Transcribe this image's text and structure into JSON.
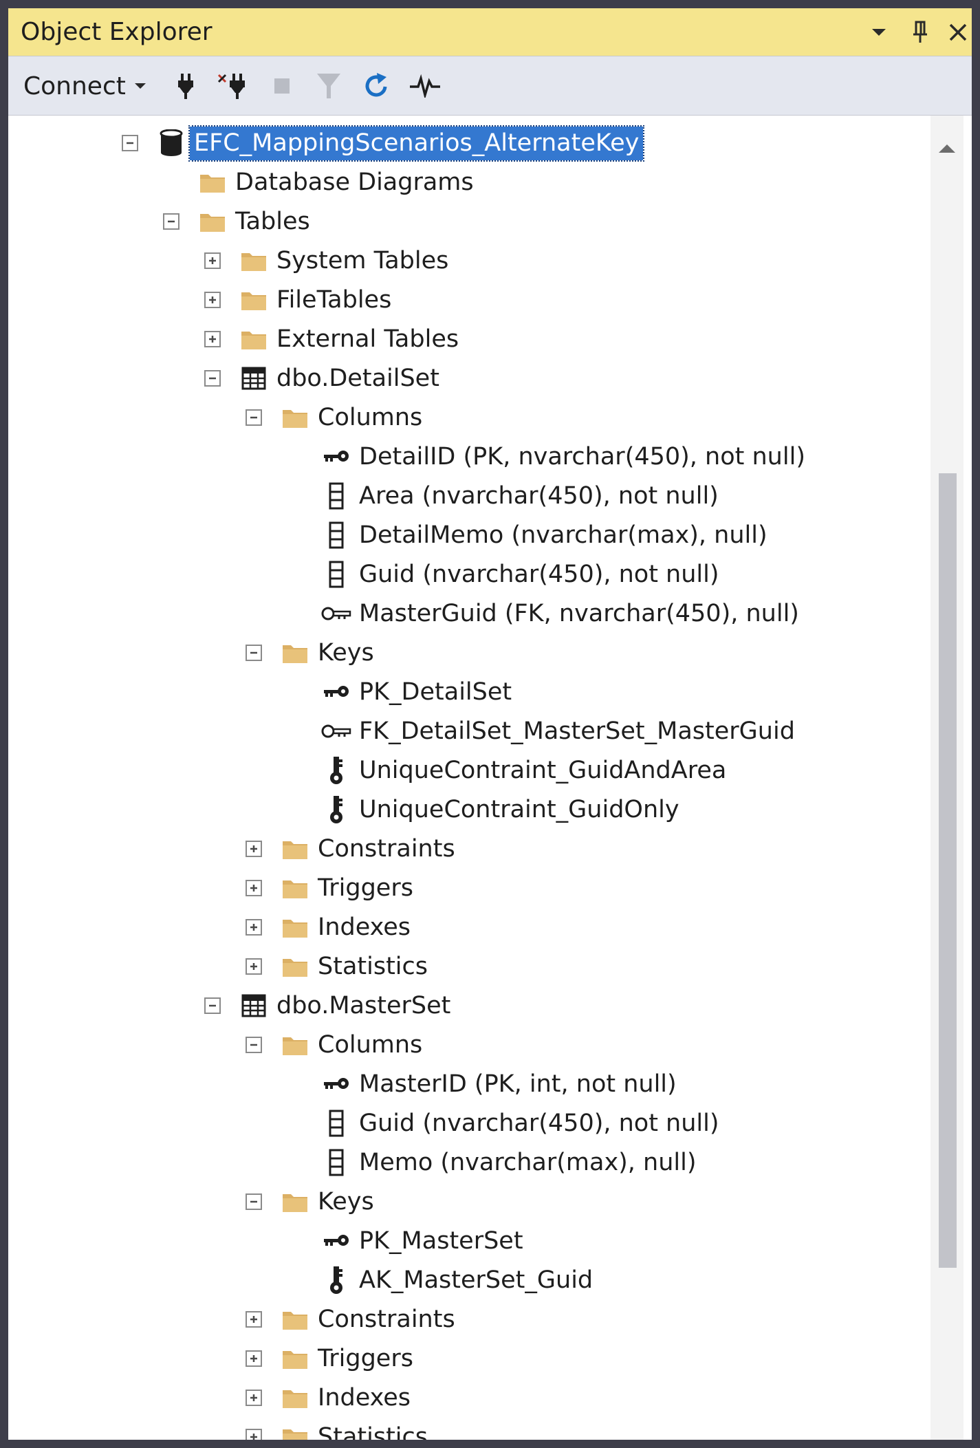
{
  "window": {
    "title": "Object Explorer",
    "controls": [
      "dropdown-arrow-icon",
      "pin-icon",
      "close-icon"
    ]
  },
  "toolbar": {
    "connect_label": "Connect",
    "tools": [
      "connect-plug-icon",
      "disconnect-icon",
      "stop-icon",
      "filter-icon",
      "refresh-icon",
      "activity-monitor-icon"
    ]
  },
  "tree": [
    {
      "label": "EFC_MappingScenarios_AlternateKey",
      "level": 0,
      "expander": "minus",
      "icon": "database-icon",
      "selected": true
    },
    {
      "label": "Database Diagrams",
      "level": 1,
      "expander": "none",
      "icon": "folder-icon"
    },
    {
      "label": "Tables",
      "level": 1,
      "expander": "minus",
      "icon": "folder-icon"
    },
    {
      "label": "System Tables",
      "level": 2,
      "expander": "plus",
      "icon": "folder-icon"
    },
    {
      "label": "FileTables",
      "level": 2,
      "expander": "plus",
      "icon": "folder-icon"
    },
    {
      "label": "External Tables",
      "level": 2,
      "expander": "plus",
      "icon": "folder-icon"
    },
    {
      "label": "dbo.DetailSet",
      "level": 2,
      "expander": "minus",
      "icon": "table-icon"
    },
    {
      "label": "Columns",
      "level": 3,
      "expander": "minus",
      "icon": "folder-icon"
    },
    {
      "label": "DetailID (PK, nvarchar(450), not null)",
      "level": 4,
      "expander": "none",
      "icon": "primary-key-icon"
    },
    {
      "label": "Area (nvarchar(450), not null)",
      "level": 4,
      "expander": "none",
      "icon": "column-icon"
    },
    {
      "label": "DetailMemo (nvarchar(max), null)",
      "level": 4,
      "expander": "none",
      "icon": "column-icon"
    },
    {
      "label": "Guid (nvarchar(450), not null)",
      "level": 4,
      "expander": "none",
      "icon": "column-icon"
    },
    {
      "label": "MasterGuid (FK, nvarchar(450), null)",
      "level": 4,
      "expander": "none",
      "icon": "foreign-key-icon"
    },
    {
      "label": "Keys",
      "level": 3,
      "expander": "minus",
      "icon": "folder-icon"
    },
    {
      "label": "PK_DetailSet",
      "level": 4,
      "expander": "none",
      "icon": "primary-key-icon"
    },
    {
      "label": "FK_DetailSet_MasterSet_MasterGuid",
      "level": 4,
      "expander": "none",
      "icon": "foreign-key-icon"
    },
    {
      "label": "UniqueContraint_GuidAndArea",
      "level": 4,
      "expander": "none",
      "icon": "unique-key-icon"
    },
    {
      "label": "UniqueContraint_GuidOnly",
      "level": 4,
      "expander": "none",
      "icon": "unique-key-icon"
    },
    {
      "label": "Constraints",
      "level": 3,
      "expander": "plus",
      "icon": "folder-icon"
    },
    {
      "label": "Triggers",
      "level": 3,
      "expander": "plus",
      "icon": "folder-icon"
    },
    {
      "label": "Indexes",
      "level": 3,
      "expander": "plus",
      "icon": "folder-icon"
    },
    {
      "label": "Statistics",
      "level": 3,
      "expander": "plus",
      "icon": "folder-icon"
    },
    {
      "label": "dbo.MasterSet",
      "level": 2,
      "expander": "minus",
      "icon": "table-icon"
    },
    {
      "label": "Columns",
      "level": 3,
      "expander": "minus",
      "icon": "folder-icon"
    },
    {
      "label": "MasterID (PK, int, not null)",
      "level": 4,
      "expander": "none",
      "icon": "primary-key-icon"
    },
    {
      "label": "Guid (nvarchar(450), not null)",
      "level": 4,
      "expander": "none",
      "icon": "column-icon"
    },
    {
      "label": "Memo (nvarchar(max), null)",
      "level": 4,
      "expander": "none",
      "icon": "column-icon"
    },
    {
      "label": "Keys",
      "level": 3,
      "expander": "minus",
      "icon": "folder-icon"
    },
    {
      "label": "PK_MasterSet",
      "level": 4,
      "expander": "none",
      "icon": "primary-key-icon"
    },
    {
      "label": "AK_MasterSet_Guid",
      "level": 4,
      "expander": "none",
      "icon": "unique-key-icon"
    },
    {
      "label": "Constraints",
      "level": 3,
      "expander": "plus",
      "icon": "folder-icon"
    },
    {
      "label": "Triggers",
      "level": 3,
      "expander": "plus",
      "icon": "folder-icon"
    },
    {
      "label": "Indexes",
      "level": 3,
      "expander": "plus",
      "icon": "folder-icon"
    },
    {
      "label": "Statistics",
      "level": 3,
      "expander": "plus",
      "icon": "folder-icon"
    }
  ],
  "colors": {
    "title_bar": "#f5e58e",
    "toolbar": "#e4e7ef",
    "selection": "#3478d0",
    "folder": "#dcb064",
    "frame": "#3e3e4a"
  }
}
